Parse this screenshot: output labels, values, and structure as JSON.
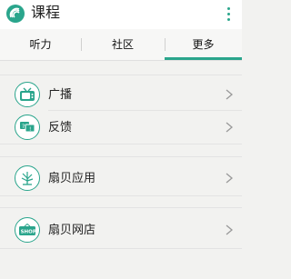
{
  "app": {
    "title": "课程",
    "accent_color": "#2aa58c"
  },
  "tabs": [
    {
      "label": "听力"
    },
    {
      "label": "社区"
    },
    {
      "label": "更多",
      "active": true
    }
  ],
  "items": [
    {
      "label": "广播",
      "icon": "tv-icon"
    },
    {
      "label": "反馈",
      "icon": "feedback-icon"
    },
    {
      "label": "扇贝应用",
      "icon": "plant-icon"
    },
    {
      "label": "扇贝网店",
      "icon": "shop-icon",
      "icon_text": "SHOP"
    }
  ]
}
